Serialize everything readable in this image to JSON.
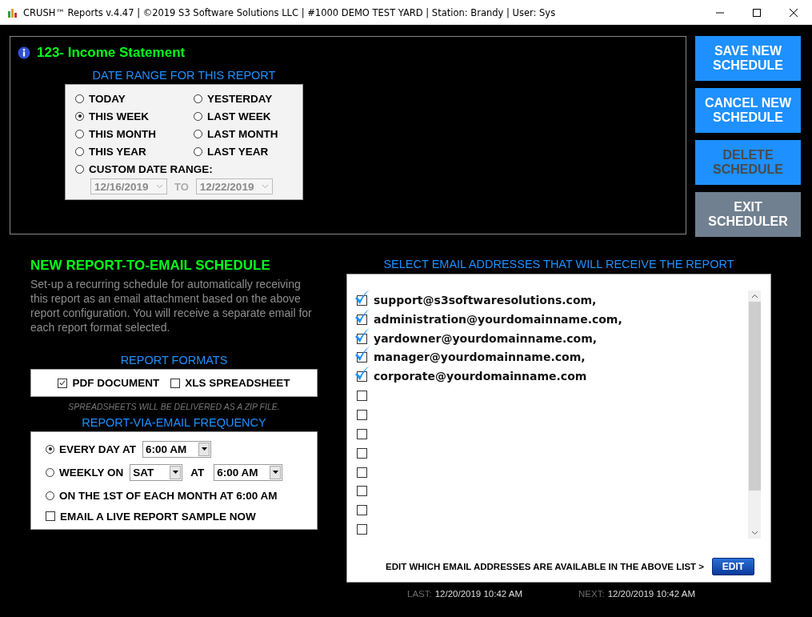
{
  "window": {
    "title": "CRUSH™ Reports v.4.47 | ©2019 S3 Software Solutions LLC | #1000 DEMO TEST YARD | Station: Brandy | User: Sys"
  },
  "report": {
    "title": "123- Income Statement"
  },
  "date_range": {
    "heading": "DATE RANGE FOR THIS REPORT",
    "options": [
      {
        "label": "TODAY",
        "selected": false
      },
      {
        "label": "YESTERDAY",
        "selected": false
      },
      {
        "label": "THIS WEEK",
        "selected": true
      },
      {
        "label": "LAST WEEK",
        "selected": false
      },
      {
        "label": "THIS MONTH",
        "selected": false
      },
      {
        "label": "LAST MONTH",
        "selected": false
      },
      {
        "label": "THIS YEAR",
        "selected": false
      },
      {
        "label": "LAST YEAR",
        "selected": false
      }
    ],
    "custom": {
      "label": "CUSTOM DATE RANGE:",
      "selected": false,
      "from": "12/16/2019",
      "to_label": "TO",
      "to": "12/22/2019",
      "disabled": true
    }
  },
  "buttons": [
    {
      "label": "SAVE NEW SCHEDULE",
      "kind": "primary",
      "disabled": false
    },
    {
      "label": "CANCEL NEW SCHEDULE",
      "kind": "primary",
      "disabled": false
    },
    {
      "label": "DELETE SCHEDULE",
      "kind": "primary",
      "disabled": true
    },
    {
      "label": "EXIT SCHEDULER",
      "kind": "secondary",
      "disabled": false
    }
  ],
  "schedule": {
    "heading": "NEW REPORT-TO-EMAIL SCHEDULE",
    "description": "Set-up a recurring schedule for automatically receiving this report as an email attachment based on the above report configuration. You will receive a separate email for each report format selected.",
    "formats": {
      "heading": "REPORT FORMATS",
      "options": [
        {
          "label": "PDF DOCUMENT",
          "checked": true
        },
        {
          "label": "XLS SPREADSHEET",
          "checked": false
        }
      ],
      "note": "SPREADSHEETS WILL BE DELIVERED AS A ZIP FILE."
    },
    "frequency": {
      "heading": "REPORT-VIA-EMAIL FREQUENCY",
      "options": [
        {
          "kind": "daily",
          "label": "EVERY DAY AT",
          "selected": true,
          "time": "6:00 AM"
        },
        {
          "kind": "weekly",
          "label": "WEEKLY ON",
          "selected": false,
          "day": "SAT",
          "at_label": "AT",
          "time": "6:00 AM"
        },
        {
          "kind": "monthly",
          "label": "ON THE 1ST OF EACH MONTH AT 6:00 AM",
          "selected": false
        }
      ],
      "sample": {
        "label": "EMAIL A LIVE REPORT SAMPLE NOW",
        "checked": false
      }
    }
  },
  "emails": {
    "heading": "SELECT EMAIL ADDRESSES THAT WILL RECEIVE THE REPORT",
    "items": [
      {
        "address": "support@s3softwaresolutions.com,",
        "checked": true
      },
      {
        "address": "administration@yourdomainname.com,",
        "checked": true
      },
      {
        "address": "yardowner@yourdomainname.com,",
        "checked": true
      },
      {
        "address": "manager@yourdomainname.com,",
        "checked": true
      },
      {
        "address": "corporate@yourdomainname.com",
        "checked": true
      },
      {
        "checked": false
      },
      {
        "checked": false
      },
      {
        "checked": false
      },
      {
        "checked": false
      },
      {
        "checked": false
      },
      {
        "checked": false
      },
      {
        "checked": false
      },
      {
        "checked": false
      }
    ],
    "edit_prompt": "EDIT WHICH EMAIL ADDRESSES ARE AVAILABLE IN THE ABOVE LIST >",
    "edit_button": "EDIT",
    "last_label": "LAST:",
    "last": "12/20/2019 10:42 AM",
    "next_label": "NEXT:",
    "next": "12/20/2019 10:42 AM"
  }
}
